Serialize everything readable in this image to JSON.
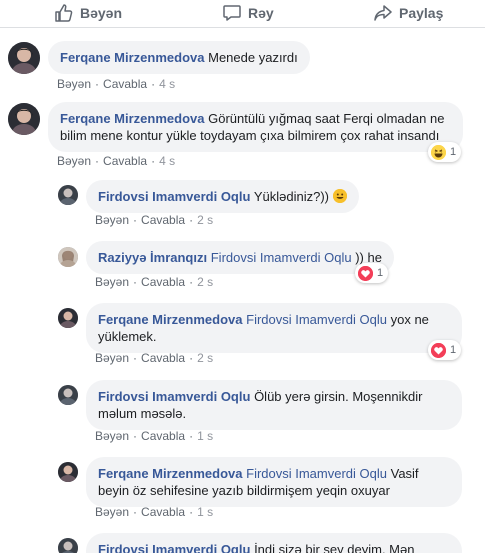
{
  "action_bar": {
    "like_label": "Bəyən",
    "reply_label": "Rəy",
    "share_label": "Paylaş"
  },
  "icons": {
    "like": "thumbs-up-icon",
    "reply": "speech-bubble-icon",
    "share": "share-arrow-icon"
  },
  "colors": {
    "author": "#385898",
    "meta": "#606770",
    "bubble": "#f2f3f5",
    "love": "#f33e58",
    "haha": "#fcd54a"
  },
  "meta_labels": {
    "like": "Bəyən",
    "reply": "Cavabla"
  },
  "comments": [
    {
      "author": "Ferqane Mirzenmedova",
      "text": "Menede yazırdı",
      "time": "4 s"
    },
    {
      "author": "Ferqane Mirzenmedova",
      "text": "Görüntülü yığmaq saat Ferqi olmadan ne bilim mene kontur yükle toydayam çıxa bilmirem çox rahat insandı",
      "time": "4 s",
      "reaction": {
        "type": "haha",
        "count": "1"
      }
    },
    {
      "author": "Firdovsi Imamverdi Oqlu",
      "text": "Yüklədiniz?))",
      "time": "2 s"
    },
    {
      "author": "Raziyyə İmranqızı",
      "mention": "Firdovsi Imamverdi Oqlu",
      "text": " )) he",
      "time": "2 s",
      "reaction": {
        "type": "love",
        "count": "1"
      }
    },
    {
      "author": "Ferqane Mirzenmedova",
      "mention": "Firdovsi Imamverdi Oqlu",
      "text": " yox ne yüklemek.",
      "time": "2 s",
      "reaction": {
        "type": "love",
        "count": "1"
      }
    },
    {
      "author": "Firdovsi Imamverdi Oqlu",
      "text": "Ölüb yerə girsin. Moşennikdir məlum məsələ.",
      "time": "1 s"
    },
    {
      "author": "Ferqane Mirzenmedova",
      "mention": "Firdovsi Imamverdi Oqlu",
      "text": " Vasif beyin öz sehifesine yazıb bildirmişem yeqin oxuyar",
      "time": "1 s"
    },
    {
      "author": "Firdovsi Imamverdi Oqlu",
      "text": "İndi sizə bir şey deyim. Mən dünən"
    }
  ]
}
